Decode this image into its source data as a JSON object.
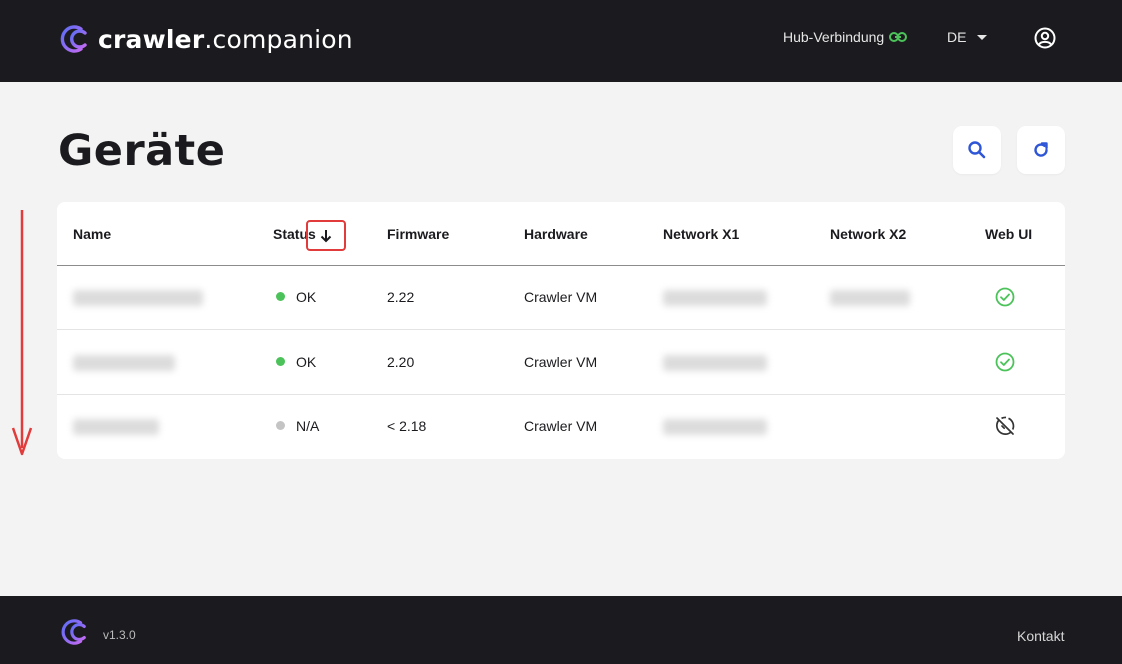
{
  "header": {
    "brand_bold": "crawler",
    "brand_light": ".companion",
    "hub_label": "Hub-Verbindung",
    "lang_label": "DE"
  },
  "page": {
    "title": "Geräte"
  },
  "table": {
    "headers": [
      "Name",
      "Status",
      "Firmware",
      "Hardware",
      "Network X1",
      "Network X2",
      "Web UI"
    ],
    "rows": [
      {
        "status": "OK",
        "status_color": "#4cc25a",
        "firmware": "2.22",
        "hardware": "Crawler VM",
        "webui": "check-circle-icon"
      },
      {
        "status": "OK",
        "status_color": "#4cc25a",
        "firmware": "2.20",
        "hardware": "Crawler VM",
        "webui": "check-circle-icon"
      },
      {
        "status": "N/A",
        "status_color": "#c4c4c4",
        "firmware": "< 2.18",
        "hardware": "Crawler VM",
        "webui": "disabled-circle-icon"
      }
    ]
  },
  "footer": {
    "version": "v1.3.0",
    "contact": "Kontakt"
  },
  "colors": {
    "dark": "#1b1b1f",
    "background": "#f3f3f3",
    "accent_blue": "#2f56d6",
    "ok_green": "#4cc25a",
    "annotation_red": "#e13b3b"
  }
}
